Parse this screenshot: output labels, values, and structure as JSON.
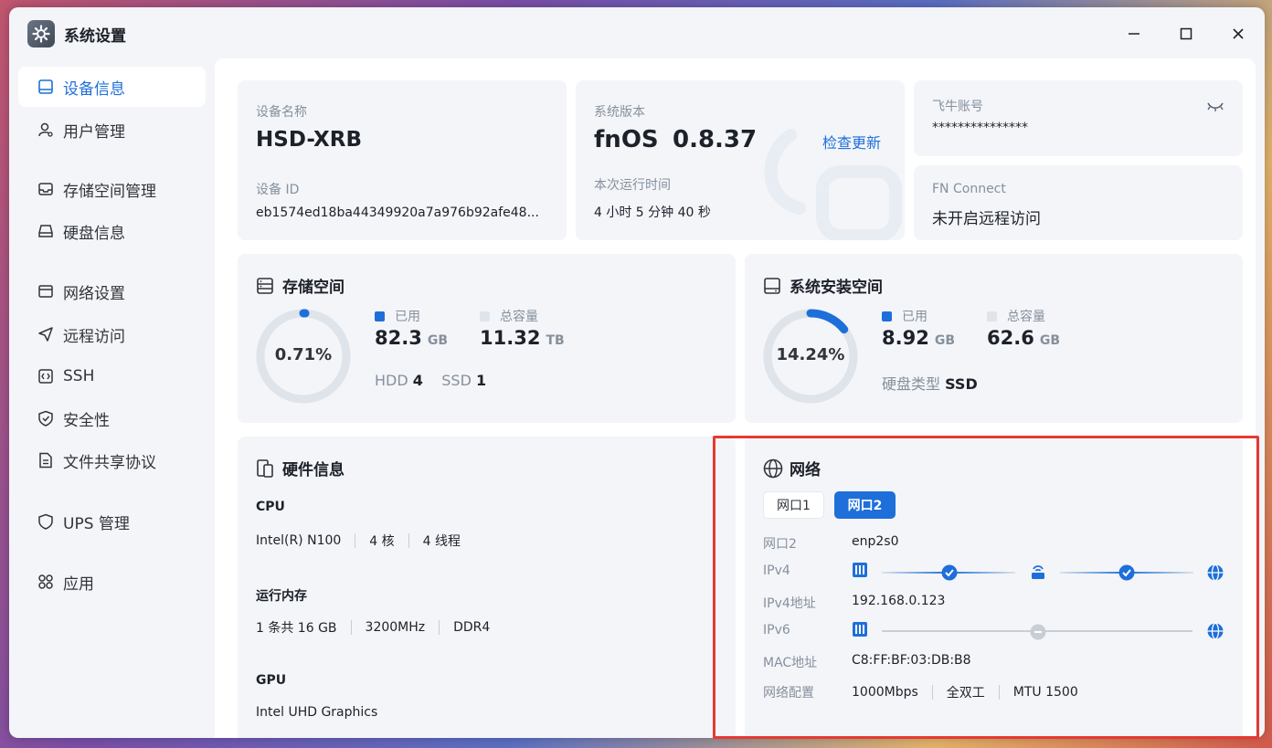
{
  "window": {
    "title": "系统设置"
  },
  "sidebar": {
    "items": [
      {
        "label": "设备信息",
        "icon": "device-icon",
        "active": true
      },
      {
        "label": "用户管理",
        "icon": "user-icon"
      },
      {
        "label": "存储空间管理",
        "icon": "storage-icon"
      },
      {
        "label": "硬盘信息",
        "icon": "disk-icon"
      },
      {
        "label": "网络设置",
        "icon": "network-icon"
      },
      {
        "label": "远程访问",
        "icon": "send-icon"
      },
      {
        "label": "SSH",
        "icon": "code-icon"
      },
      {
        "label": "安全性",
        "icon": "shield-check-icon"
      },
      {
        "label": "文件共享协议",
        "icon": "file-icon"
      },
      {
        "label": "UPS 管理",
        "icon": "shield-icon"
      },
      {
        "label": "应用",
        "icon": "apps-icon"
      }
    ]
  },
  "device": {
    "name_label": "设备名称",
    "name": "HSD-XRB",
    "id_label": "设备 ID",
    "id": "eb1574ed18ba44349920a7a976b92afe48..."
  },
  "system": {
    "version_label": "系统版本",
    "os": "fnOS",
    "version": "0.8.37",
    "check_update": "检查更新",
    "uptime_label": "本次运行时间",
    "uptime": "4 小时 5 分钟 40 秒"
  },
  "account": {
    "label": "飞牛账号",
    "value": "***************"
  },
  "fn_connect": {
    "label": "FN Connect",
    "value": "未开启远程访问"
  },
  "storage": {
    "title": "存储空间",
    "percent_text": "0.71%",
    "percent": 0.71,
    "used_label": "已用",
    "used_value": "82.3",
    "used_unit": "GB",
    "total_label": "总容量",
    "total_value": "11.32",
    "total_unit": "TB",
    "hdd_label": "HDD",
    "hdd_count": "4",
    "ssd_label": "SSD",
    "ssd_count": "1"
  },
  "sys_space": {
    "title": "系统安装空间",
    "percent_text": "14.24%",
    "percent": 14.24,
    "used_label": "已用",
    "used_value": "8.92",
    "used_unit": "GB",
    "total_label": "总容量",
    "total_value": "62.6",
    "total_unit": "GB",
    "disk_type_label": "硬盘类型",
    "disk_type": "SSD"
  },
  "hardware": {
    "title": "硬件信息",
    "cpu_label": "CPU",
    "cpu_model": "Intel(R) N100",
    "cpu_cores": "4 核",
    "cpu_threads": "4 线程",
    "mem_label": "运行内存",
    "mem_size": "1 条共 16 GB",
    "mem_freq": "3200MHz",
    "mem_type": "DDR4",
    "gpu_label": "GPU",
    "gpu_model": "Intel UHD Graphics"
  },
  "network": {
    "title": "网络",
    "tabs": [
      "网口1",
      "网口2"
    ],
    "active_tab": 1,
    "port_label": "网口2",
    "port_value": "enp2s0",
    "ipv4_label": "IPv4",
    "ipv4_addr_label": "IPv4地址",
    "ipv4_addr": "192.168.0.123",
    "ipv6_label": "IPv6",
    "mac_label": "MAC地址",
    "mac": "C8:FF:BF:03:DB:B8",
    "config_label": "网络配置",
    "speed": "1000Mbps",
    "duplex": "全双工",
    "mtu": "MTU 1500"
  },
  "colors": {
    "accent": "#1e6fd9",
    "highlight_box": "#e53a32",
    "ring_track": "#dfe3ea"
  }
}
